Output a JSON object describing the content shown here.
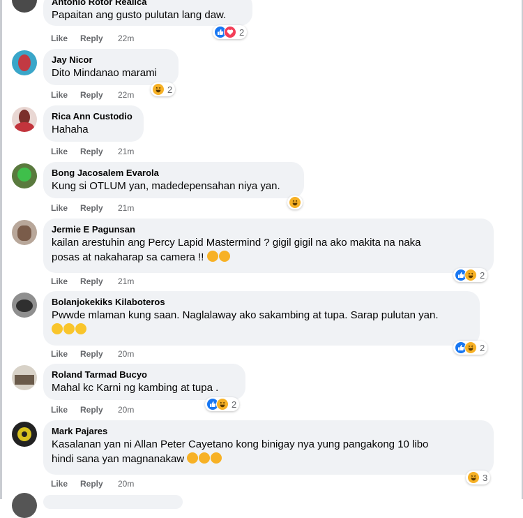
{
  "actions": {
    "like": "Like",
    "reply": "Reply"
  },
  "colors": {
    "bubble": "#f0f2f5",
    "meta": "#65676b",
    "like_blue": "#1877f2",
    "love_red": "#f33e58",
    "haha_yellow": "#f7b125"
  },
  "comments": [
    {
      "author": "Antonio Rotor Realica",
      "lines": [
        "Papaitan ang gusto pulutan lang daw."
      ],
      "time": "22m",
      "reactions": {
        "icons": [
          "like-icon",
          "love-icon"
        ],
        "count": "2"
      }
    },
    {
      "author": "Jay Nicor",
      "lines": [
        "Dito Mindanao marami"
      ],
      "time": "22m",
      "reactions": {
        "icons": [
          "haha-icon"
        ],
        "count": "2"
      }
    },
    {
      "author": "Rica Ann Custodio",
      "lines": [
        "Hahaha"
      ],
      "time": "21m",
      "reactions": null
    },
    {
      "author": "Bong Jacosalem Evarola",
      "lines": [
        "Kung si OTLUM yan, madedepensahan niya yan."
      ],
      "time": "21m",
      "reactions": {
        "icons": [
          "haha-icon"
        ],
        "count": ""
      }
    },
    {
      "author": "Jermie E Pagunsan",
      "lines": [
        "kailan arestuhin ang Percy Lapid Mastermind ? gigil gigil na ako makita na naka",
        "posas at nakaharap sa camera !!"
      ],
      "time": "21m",
      "inline_emojis": [
        "laughing-emoji",
        "laughing-emoji"
      ],
      "reactions": {
        "icons": [
          "like-icon",
          "haha-icon"
        ],
        "count": "2"
      }
    },
    {
      "author": "Bolanjokekiks Kilaboteros",
      "lines": [
        "Pwwde mlaman kung saan. Naglalaway ako sakambing at tupa. Sarap pulutan yan."
      ],
      "time": "20m",
      "inline_emojis": [
        "smile-emoji",
        "smile-emoji",
        "smile-emoji"
      ],
      "reactions": {
        "icons": [
          "like-icon",
          "haha-icon"
        ],
        "count": "2"
      }
    },
    {
      "author": "Roland Tarmad Bucyo",
      "lines": [
        "Mahal kc Karni ng kambing at tupa ."
      ],
      "time": "20m",
      "reactions": {
        "icons": [
          "like-icon",
          "haha-icon"
        ],
        "count": "2"
      }
    },
    {
      "author": "Mark Pajares",
      "lines": [
        "Kasalanan yan ni Allan Peter Cayetano kong binigay nya yung pangakong 10 libo",
        "hindi sana yan magnanakaw"
      ],
      "time": "20m",
      "inline_emojis": [
        "laughing-emoji",
        "laughing-emoji",
        "laughing-emoji"
      ],
      "reactions": {
        "icons": [
          "haha-icon"
        ],
        "count": "3"
      }
    }
  ]
}
